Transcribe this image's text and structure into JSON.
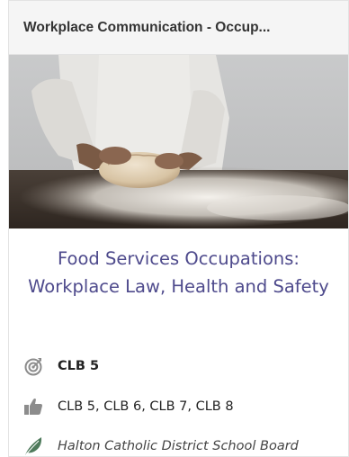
{
  "card": {
    "header_title": "Workplace Communication - Occup...",
    "course_title": "Food Services Occupations: Workplace Law, Health and Safety",
    "clb_level": "CLB 5",
    "clb_range": "CLB 5, CLB 6, CLB 7, CLB 8",
    "school_board": "Halton Catholic District School Board",
    "icons": {
      "level": "target-icon",
      "range": "thumbs-up-icon",
      "board": "leaf-icon"
    },
    "colors": {
      "title": "#4e4a8c",
      "header_bg": "#f5f5f5",
      "icon_gray": "#8c8c8c",
      "leaf_green": "#4f7b5c"
    }
  }
}
